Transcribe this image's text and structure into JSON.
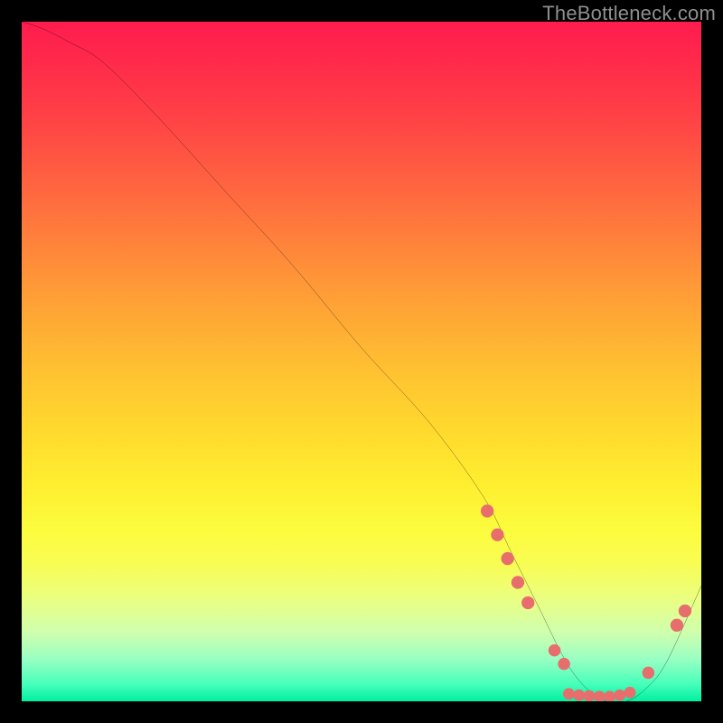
{
  "watermark": {
    "text": "TheBottleneck.com"
  },
  "chart_data": {
    "type": "line",
    "title": "",
    "xlabel": "",
    "ylabel": "",
    "xlim": [
      0,
      100
    ],
    "ylim": [
      0,
      100
    ],
    "grid": false,
    "legend": false,
    "background_gradient": {
      "orientation": "vertical",
      "stops": [
        {
          "pos": 0.0,
          "color": "#ff1c4f"
        },
        {
          "pos": 0.4,
          "color": "#ff9a37"
        },
        {
          "pos": 0.7,
          "color": "#fff632"
        },
        {
          "pos": 0.9,
          "color": "#ceffaf"
        },
        {
          "pos": 1.0,
          "color": "#00f0a0"
        }
      ]
    },
    "series": [
      {
        "name": "bottleneck-curve",
        "color": "#000000",
        "x": [
          0,
          3,
          7,
          12,
          20,
          30,
          40,
          50,
          60,
          68,
          72,
          76,
          80,
          83,
          86,
          89,
          92,
          95,
          100
        ],
        "values": [
          100,
          99,
          97,
          94,
          86,
          75,
          64,
          52,
          41,
          30,
          22,
          14,
          6,
          2,
          0,
          0,
          2,
          6,
          17
        ]
      }
    ],
    "markers": [
      {
        "name": "left-cluster-marker",
        "shape": "circle",
        "color": "#e86d6d",
        "cx": 68.5,
        "cy": 28.0,
        "r": 0.95
      },
      {
        "name": "left-cluster-marker",
        "shape": "circle",
        "color": "#e86d6d",
        "cx": 70.0,
        "cy": 24.5,
        "r": 0.95
      },
      {
        "name": "left-cluster-marker",
        "shape": "circle",
        "color": "#e86d6d",
        "cx": 71.5,
        "cy": 21.0,
        "r": 0.95
      },
      {
        "name": "left-cluster-marker",
        "shape": "circle",
        "color": "#e86d6d",
        "cx": 73.0,
        "cy": 17.5,
        "r": 0.95
      },
      {
        "name": "left-cluster-marker",
        "shape": "circle",
        "color": "#e86d6d",
        "cx": 74.5,
        "cy": 14.5,
        "r": 0.95
      },
      {
        "name": "trough-marker",
        "shape": "circle",
        "color": "#e86d6d",
        "cx": 78.4,
        "cy": 7.5,
        "r": 0.9
      },
      {
        "name": "trough-marker",
        "shape": "circle",
        "color": "#e86d6d",
        "cx": 79.8,
        "cy": 5.5,
        "r": 0.9
      },
      {
        "name": "trough-marker",
        "shape": "circle",
        "color": "#e86d6d",
        "cx": 80.5,
        "cy": 1.1,
        "r": 0.85
      },
      {
        "name": "trough-marker",
        "shape": "circle",
        "color": "#e86d6d",
        "cx": 82.0,
        "cy": 0.9,
        "r": 0.85
      },
      {
        "name": "trough-marker",
        "shape": "circle",
        "color": "#e86d6d",
        "cx": 83.5,
        "cy": 0.8,
        "r": 0.85
      },
      {
        "name": "trough-marker",
        "shape": "circle",
        "color": "#e86d6d",
        "cx": 85.0,
        "cy": 0.7,
        "r": 0.85
      },
      {
        "name": "trough-marker",
        "shape": "circle",
        "color": "#e86d6d",
        "cx": 86.5,
        "cy": 0.7,
        "r": 0.85
      },
      {
        "name": "trough-marker",
        "shape": "circle",
        "color": "#e86d6d",
        "cx": 88.0,
        "cy": 0.9,
        "r": 0.85
      },
      {
        "name": "trough-marker",
        "shape": "circle",
        "color": "#e86d6d",
        "cx": 89.5,
        "cy": 1.3,
        "r": 0.85
      },
      {
        "name": "right-marker",
        "shape": "circle",
        "color": "#e86d6d",
        "cx": 92.2,
        "cy": 4.2,
        "r": 0.9
      },
      {
        "name": "right-marker",
        "shape": "circle",
        "color": "#e86d6d",
        "cx": 96.4,
        "cy": 11.2,
        "r": 0.95
      },
      {
        "name": "right-marker",
        "shape": "circle",
        "color": "#e86d6d",
        "cx": 97.6,
        "cy": 13.3,
        "r": 0.95
      }
    ]
  }
}
